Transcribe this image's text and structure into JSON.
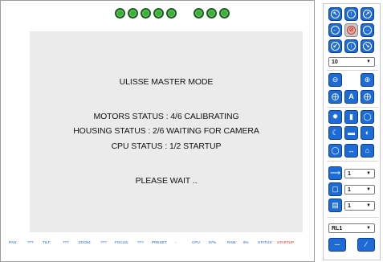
{
  "leds": {
    "group1_count": 5,
    "group2_count": 3,
    "color": "#3cae3c"
  },
  "screen": {
    "title": "ULISSE MASTER MODE",
    "motors_status": "MOTORS STATUS : 4/6 CALIBRATING",
    "housing_status": "HOUSING STATUS : 2/6 WAITING FOR CAMERA",
    "cpu_status": "CPU STATUS : 1/2 STARTUP",
    "please_wait": "PLEASE WAIT .."
  },
  "statusbar": {
    "pan_label": "PAN:",
    "pan_value": "???",
    "tilt_label": "TILT:",
    "tilt_value": "???",
    "zoom_label": "ZOOM:",
    "zoom_value": "???",
    "focus_label": "FOCUS:",
    "focus_value": "???",
    "preset_label": "PRESET:",
    "preset_value": "-",
    "cpu_label": "CPU:",
    "cpu_value": "57%",
    "ram_label": "RAM:",
    "ram_value": "6%",
    "status_label": "STATUS:",
    "status_value": "STARTUP",
    "status_color": "#e0301e",
    "text_color": "#1e5fbf"
  },
  "panel": {
    "speed_select": "10",
    "preset_goto_select": "1",
    "preset_save_select": "1",
    "preset_erase_select": "1",
    "relay_select": "RL1",
    "icons": {
      "up_left": "arrow-up-left-icon",
      "up": "arrow-up-icon",
      "up_right": "arrow-up-right-icon",
      "left": "arrow-left-icon",
      "stop": "stop-icon",
      "right": "arrow-right-icon",
      "down_left": "arrow-down-left-icon",
      "down": "arrow-down-icon",
      "down_right": "arrow-down-right-icon"
    }
  }
}
